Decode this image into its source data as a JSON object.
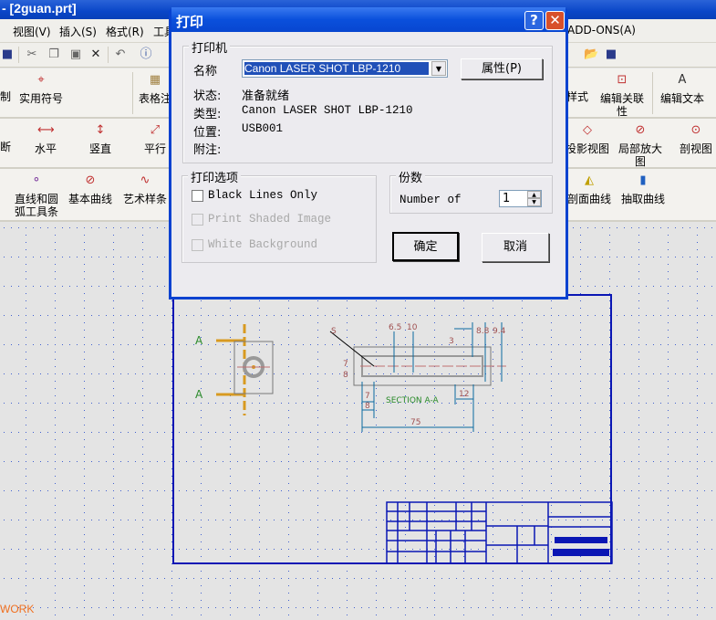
{
  "app": {
    "title": "- [2guan.prt]"
  },
  "menu": [
    "视图(V)",
    "插入(S)",
    "格式(R)",
    "工具",
    "ADD-ONS(A)"
  ],
  "toolbar_icons": [
    "save-icon",
    "cut-icon",
    "copy-icon",
    "paste-icon",
    "delete-icon",
    "undo-icon",
    "info-icon",
    "open-folder-icon",
    "save-icon"
  ],
  "ribbon": {
    "row1": [
      "制",
      "实用符号",
      "表格注",
      "样式",
      "编辑关联性",
      "编辑文本"
    ],
    "row2": [
      "断",
      "水平",
      "竖直",
      "平行",
      "投影视图",
      "局部放大图",
      "剖视图"
    ],
    "row3": [
      "直线和圆弧工具条",
      "基本曲线",
      "艺术样条",
      "剖面曲线",
      "抽取曲线"
    ]
  },
  "drawing": {
    "section_marks": [
      "A",
      "A"
    ],
    "section_label": "SECTION A-A",
    "dims": [
      "S",
      "6.5",
      "10",
      "3",
      "8.8",
      "9.4",
      "7",
      "8",
      "7",
      "8",
      "12",
      "75"
    ],
    "status": "WORK",
    "line_color": "#0a16b4"
  },
  "dialog": {
    "title": "打印",
    "help": "?",
    "printer_group": "打印机",
    "name_label": "名称",
    "name_value": "Canon LASER SHOT LBP-1210",
    "properties_button": "属性(P)",
    "status_label": "状态:",
    "status_value": "准备就绪",
    "type_label": "类型:",
    "type_value": "Canon LASER SHOT LBP-1210",
    "location_label": "位置:",
    "location_value": "USB001",
    "comment_label": "附注:",
    "options_group": "打印选项",
    "options": [
      {
        "label": "Black Lines Only",
        "checked": false,
        "enabled": true
      },
      {
        "label": "Print Shaded Image",
        "checked": false,
        "enabled": false
      },
      {
        "label": "White Background",
        "checked": false,
        "enabled": false
      }
    ],
    "copies_group": "份数",
    "copies_label": "Number of",
    "copies_value": "1",
    "ok": "确定",
    "cancel": "取消"
  }
}
